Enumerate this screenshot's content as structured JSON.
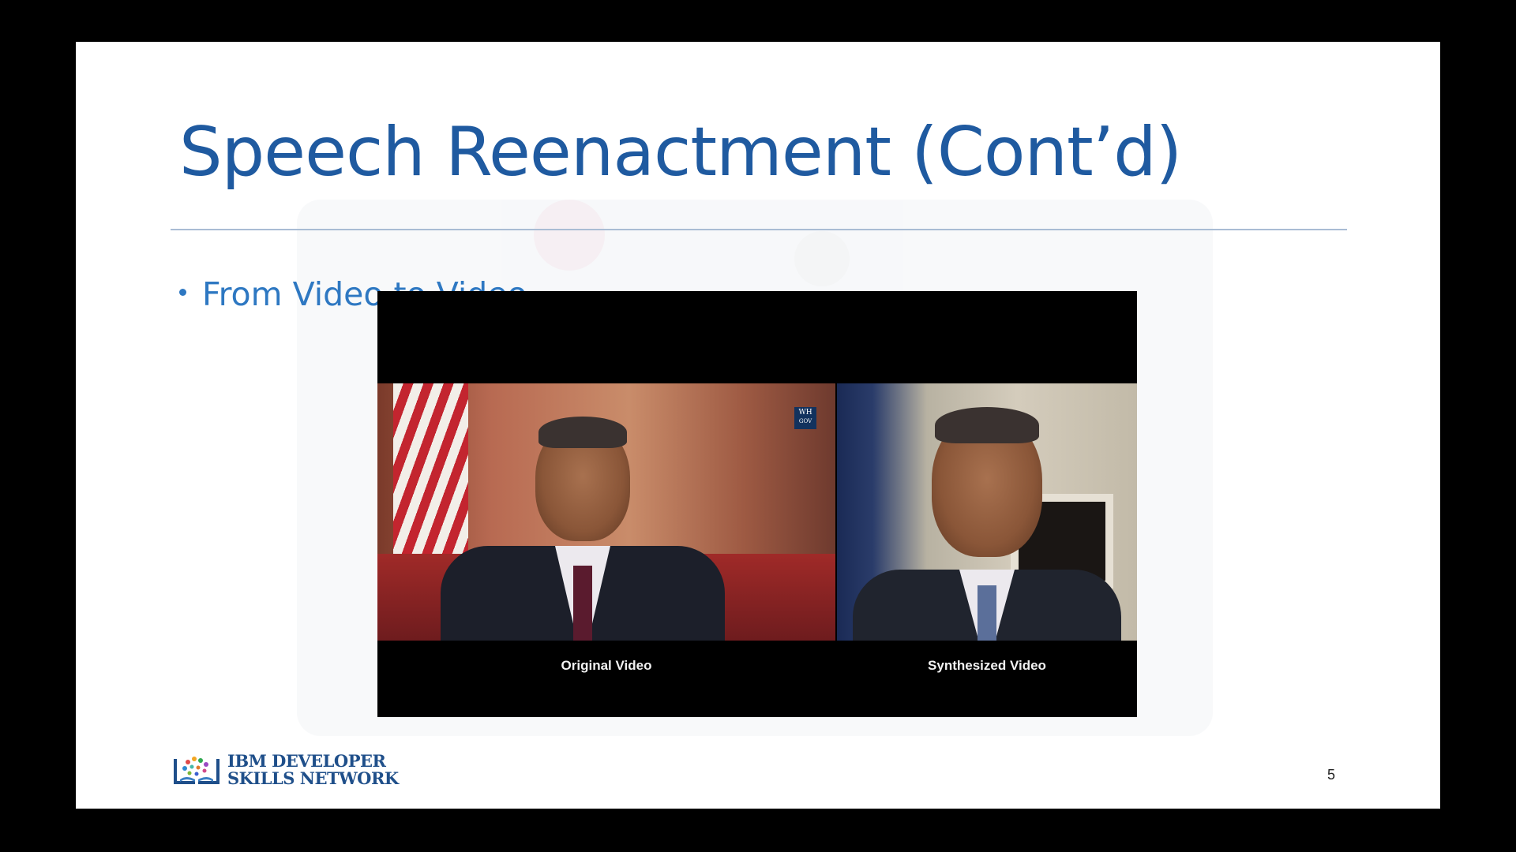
{
  "slide": {
    "title": "Speech Reenactment (Cont’d)",
    "bullet": "From Video to Video",
    "page_number": "5"
  },
  "video": {
    "left_caption": "Original Video",
    "right_caption": "Synthesized Video",
    "badge_line1": "WH",
    "badge_line2": "GOV"
  },
  "logo": {
    "line1": "IBM DEVELOPER",
    "line2": "SKILLS NETWORK",
    "icon": "book-tree-icon"
  },
  "colors": {
    "title": "#1f5aa0",
    "bullet": "#2e78c2",
    "logo_text": "#1f4f8a",
    "background": "#000000"
  }
}
